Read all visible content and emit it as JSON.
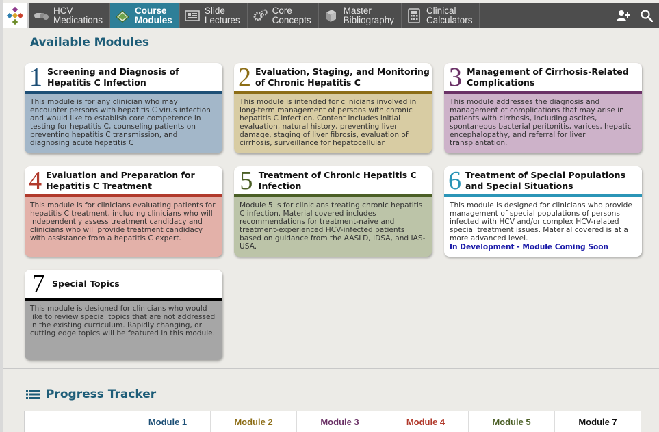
{
  "nav": {
    "items": [
      {
        "id": "hcv-medications",
        "label": "HCV\nMedications",
        "icon": "pills-icon",
        "active": false
      },
      {
        "id": "course-modules",
        "label": "Course\nModules",
        "icon": "book-icon",
        "active": true
      },
      {
        "id": "slide-lectures",
        "label": "Slide\nLectures",
        "icon": "slides-icon",
        "active": false
      },
      {
        "id": "core-concepts",
        "label": "Core\nConcepts",
        "icon": "gears-icon",
        "active": false
      },
      {
        "id": "master-bibliography",
        "label": "Master\nBibliography",
        "icon": "books-icon",
        "active": false
      },
      {
        "id": "clinical-calculators",
        "label": "Clinical\nCalculators",
        "icon": "calculator-icon",
        "active": false
      }
    ]
  },
  "main": {
    "title": "Available Modules"
  },
  "modules": [
    {
      "num": "1",
      "title": "Screening and Diagnosis of Hepatitis C Infection",
      "color": "#1d4f76",
      "bg": "#a3b7c9",
      "body": "This module is for any clinician who may encounter persons with hepatitis C virus infection and would like to establish core competence in testing for hepatitis C, counseling patients on preventing hepatitis C transmission, and diagnosing acute hepatitis C",
      "note": ""
    },
    {
      "num": "2",
      "title": "Evaluation, Staging, and Monitoring of Chronic Hepatitis C",
      "color": "#8c6d16",
      "bg": "#d8cca3",
      "body": "This module is intended for clinicians involved in long-term management of persons with chronic hepatitis C infection. Content includes initial evaluation, natural history, preventing liver damage, staging of liver fibrosis, evaluation of cirrhosis, surveillance for hepatocellular",
      "note": ""
    },
    {
      "num": "3",
      "title": "Management of Cirrhosis-Related Complications",
      "color": "#6a3166",
      "bg": "#cdb2c9",
      "body": "This module addresses the diagnosis and management of complications that may arise in patients with cirrhosis, including ascites, spontaneous bacterial peritonitis, varices, hepatic encephalopathy, and referral for liver transplantation.",
      "note": ""
    },
    {
      "num": "4",
      "title": "Evaluation and Preparation for Hepatitis C Treatment",
      "color": "#b13a2c",
      "bg": "#e3b1a9",
      "body": "This module is for clinicians evaluating patients for hepatitis C treatment, including clinicians who will independently assess treatment candidacy and clinicians who will provide treatment candidacy with assistance from a hepatitis C expert.",
      "note": ""
    },
    {
      "num": "5",
      "title": "Treatment of Chronic Hepatitis C Infection",
      "color": "#4b5f26",
      "bg": "#bcc4a8",
      "body": "Module 5 is for clinicians treating chronic hepatitis C infection. Material covered includes recommendations for treatment-naive and treatment-experienced HCV-infected patients based on guidance from the AASLD, IDSA, and IAS-USA.",
      "note": ""
    },
    {
      "num": "6",
      "title": "Treatment of Special Populations and Special Situations",
      "color": "#2b95b7",
      "bg": "#ffffff",
      "body": "This module is designed for clinicians who provide management of special populations of persons infected with HCV and/or complex HCV-related special treatment issues. Material covered is at a more advanced level.",
      "note": "In Development - Module Coming Soon"
    },
    {
      "num": "7",
      "title": "Special Topics",
      "color": "#000000",
      "bg": "#a6a6a6",
      "body": "This module is designed for clinicians who would like to review special topics that are not addressed in the existing curriculum. Rapidly changing, or cutting edge topics will be featured in this module.",
      "note": ""
    }
  ],
  "tracker": {
    "title": "Progress Tracker",
    "columns": [
      {
        "label": "",
        "color": "#333333"
      },
      {
        "label": "Module 1",
        "color": "#1d4f76"
      },
      {
        "label": "Module 2",
        "color": "#8c6d16"
      },
      {
        "label": "Module 3",
        "color": "#6a3166"
      },
      {
        "label": "Module 4",
        "color": "#b13a2c"
      },
      {
        "label": "Module 5",
        "color": "#4b5f26"
      },
      {
        "label": "Module 7",
        "color": "#111111"
      }
    ]
  }
}
